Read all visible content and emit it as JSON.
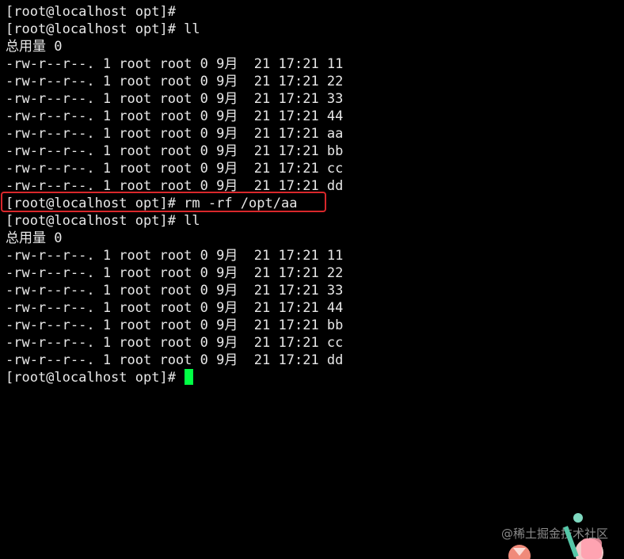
{
  "terminal": {
    "lines": [
      "[root@localhost opt]#",
      "[root@localhost opt]# ll",
      "总用量 0",
      "-rw-r--r--. 1 root root 0 9月  21 17:21 11",
      "-rw-r--r--. 1 root root 0 9月  21 17:21 22",
      "-rw-r--r--. 1 root root 0 9月  21 17:21 33",
      "-rw-r--r--. 1 root root 0 9月  21 17:21 44",
      "-rw-r--r--. 1 root root 0 9月  21 17:21 aa",
      "-rw-r--r--. 1 root root 0 9月  21 17:21 bb",
      "-rw-r--r--. 1 root root 0 9月  21 17:21 cc",
      "-rw-r--r--. 1 root root 0 9月  21 17:21 dd",
      "[root@localhost opt]# rm -rf /opt/aa",
      "[root@localhost opt]# ll",
      "总用量 0",
      "-rw-r--r--. 1 root root 0 9月  21 17:21 11",
      "-rw-r--r--. 1 root root 0 9月  21 17:21 22",
      "-rw-r--r--. 1 root root 0 9月  21 17:21 33",
      "-rw-r--r--. 1 root root 0 9月  21 17:21 44",
      "-rw-r--r--. 1 root root 0 9月  21 17:21 bb",
      "-rw-r--r--. 1 root root 0 9月  21 17:21 cc",
      "-rw-r--r--. 1 root root 0 9月  21 17:21 dd"
    ],
    "prompt": "[root@localhost opt]# ",
    "highlighted_line_index": 11
  },
  "watermark": "@稀土掘金技术社区",
  "colors": {
    "background": "#000000",
    "text": "#e8e8e8",
    "cursor": "#00ff44",
    "highlight_border": "#d9272b"
  },
  "icons": {
    "mascot": "juejin-mascot-icon"
  }
}
